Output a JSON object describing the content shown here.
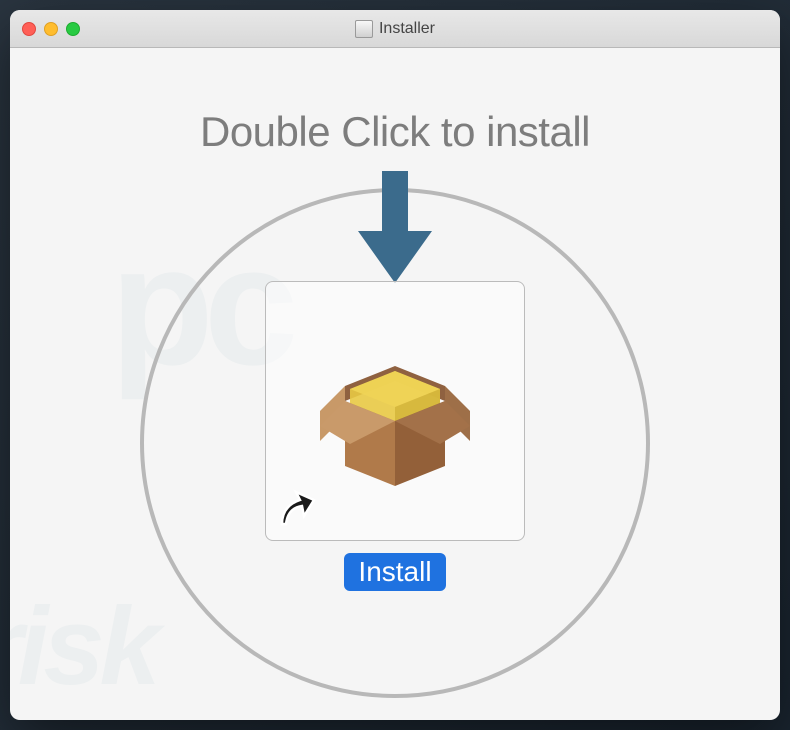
{
  "titlebar": {
    "title": "Installer"
  },
  "content": {
    "instruction": "Double Click to install",
    "install_label": "Install"
  },
  "icons": {
    "close": "close-icon",
    "minimize": "minimize-icon",
    "maximize": "maximize-icon",
    "disk": "disk-icon",
    "arrow_down": "arrow-down-icon",
    "package": "package-icon",
    "shortcut": "shortcut-arrow-icon"
  },
  "colors": {
    "accent_blue": "#1f72e0",
    "arrow_blue": "#3b6b8c",
    "box_brown": "#b07a4a",
    "box_yellow": "#e8c944"
  }
}
